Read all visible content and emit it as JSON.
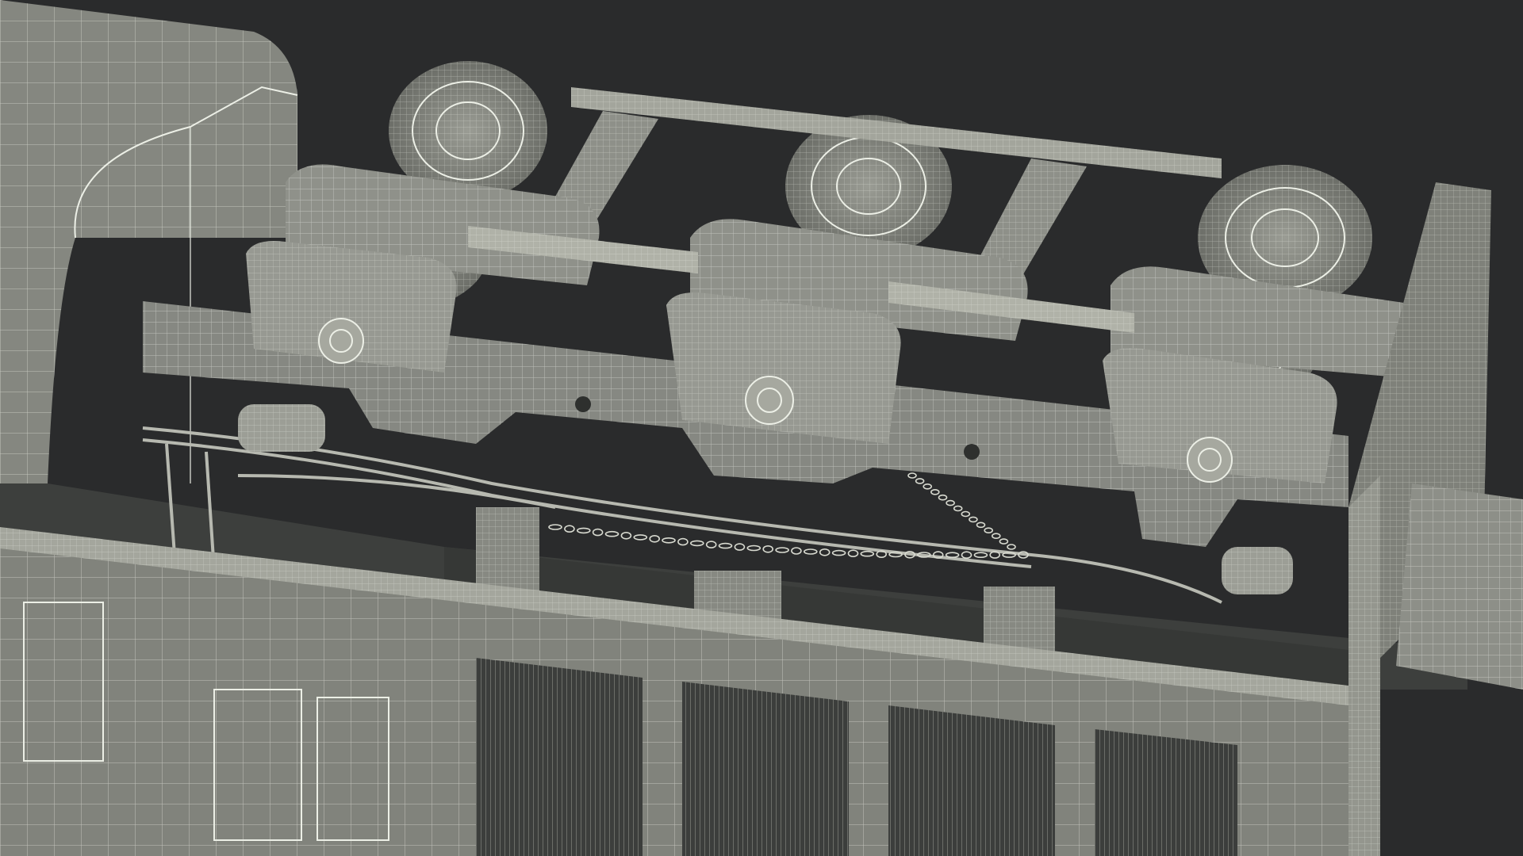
{
  "scene": {
    "subject": "locomotive-bogie-wireframe-render",
    "colors": {
      "background": "#2a2b2c",
      "surface": "#858780",
      "surface_light": "#a3a59c",
      "surface_dark": "#5e605b",
      "wire": "#ecefe6",
      "shadow": "#3a3c3a"
    },
    "wheels": {
      "top_row_count": 3,
      "front_row_count": 3
    },
    "chain_links": 34
  }
}
